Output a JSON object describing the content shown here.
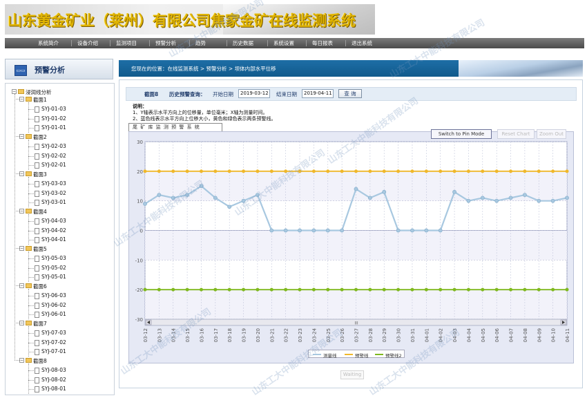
{
  "banner": {
    "title": "山东黄金矿业（莱州）有限公司焦家金矿在线监测系统"
  },
  "menu": [
    {
      "label": "系统简介"
    },
    {
      "label": "设备介绍"
    },
    {
      "label": "监测项目"
    },
    {
      "label": "预警分析"
    },
    {
      "label": "趋势"
    },
    {
      "label": "历史数据"
    },
    {
      "label": "系统设置"
    },
    {
      "label": "每日报表"
    },
    {
      "label": "退出系统"
    }
  ],
  "sidebar": {
    "icon": "chart-icon",
    "title": "预警分析",
    "tree": {
      "root": "浸润线分析",
      "groups": [
        {
          "label": "截面1",
          "items": [
            "SYJ-01-03",
            "SYJ-01-02",
            "SYJ-01-01"
          ]
        },
        {
          "label": "截面2",
          "items": [
            "SYJ-02-03",
            "SYJ-02-02",
            "SYJ-02-01"
          ]
        },
        {
          "label": "截面3",
          "items": [
            "SYJ-03-03",
            "SYJ-03-02",
            "SYJ-03-01"
          ]
        },
        {
          "label": "截面4",
          "items": [
            "SYJ-04-03",
            "SYJ-04-02",
            "SYJ-04-01"
          ]
        },
        {
          "label": "截面5",
          "items": [
            "SYJ-05-03",
            "SYJ-05-02",
            "SYJ-05-01"
          ]
        },
        {
          "label": "截面6",
          "items": [
            "SYJ-06-03",
            "SYJ-06-02",
            "SYJ-06-01"
          ]
        },
        {
          "label": "截面7",
          "items": [
            "SYJ-07-03",
            "SYJ-07-02",
            "SYJ-07-01"
          ]
        },
        {
          "label": "截面8",
          "items": [
            "SYJ-08-03",
            "SYJ-08-02",
            "SYJ-08-01"
          ]
        }
      ]
    }
  },
  "breadcrumb": {
    "text": "您现在的位置：在线监测系统 > 预警分析 > 坝体内部水平位移"
  },
  "query": {
    "section": "截面8",
    "history_label": "历史预警查询：",
    "start_label": "开始日期",
    "start_value": "2019-03-12",
    "end_label": "结束日期",
    "end_value": "2019-04-11",
    "button": "查 询"
  },
  "notes": {
    "heading": "说明：",
    "line1": "1、Y轴表示水平方向上的位移量，单位毫米；X轴为测量时间。",
    "line2": "2、蓝色线表示水平方向上位移大小，黄色和绿色表示两条预警线。"
  },
  "chart_panel": {
    "tab": "尾 矿 库 监 测 预 警 系 统",
    "pin_button": "Switch to Pin Mode",
    "reset_button": "Reset Chart",
    "zoom_button": "Zoom Out",
    "waiting": "Waiting",
    "scroll_grip": "III"
  },
  "watermark": "山东工大中能科技有限公司",
  "colors": {
    "measured": "#a8c8e0",
    "warn1": "#f0b82a",
    "warn2": "#7fb81e"
  },
  "chart_data": {
    "type": "line",
    "x": [
      "03-12",
      "03-13",
      "03-14",
      "03-15",
      "03-16",
      "03-17",
      "03-18",
      "03-19",
      "03-20",
      "03-21",
      "03-22",
      "03-23",
      "03-24",
      "03-25",
      "03-26",
      "03-27",
      "03-28",
      "03-29",
      "03-30",
      "03-31",
      "04-01",
      "04-02",
      "04-03",
      "04-04",
      "04-05",
      "04-06",
      "04-07",
      "04-08",
      "04-09",
      "04-10",
      "04-11"
    ],
    "ylim": [
      -30,
      30
    ],
    "yticks": [
      30,
      20,
      10,
      0,
      -10,
      -20,
      -30
    ],
    "series": [
      {
        "name": "测量线",
        "color": "#a8c8e0",
        "values": [
          9,
          12,
          11,
          12,
          15,
          11,
          8,
          10,
          12,
          0,
          0,
          0,
          0,
          0,
          0,
          14,
          11,
          13,
          0,
          0,
          0,
          0,
          13,
          10,
          11,
          10,
          11,
          12,
          10,
          10,
          11
        ]
      },
      {
        "name": "预警线",
        "color": "#f0b82a",
        "values": [
          20,
          20,
          20,
          20,
          20,
          20,
          20,
          20,
          20,
          20,
          20,
          20,
          20,
          20,
          20,
          20,
          20,
          20,
          20,
          20,
          20,
          20,
          20,
          20,
          20,
          20,
          20,
          20,
          20,
          20,
          20
        ]
      },
      {
        "name": "预警线2",
        "color": "#7fb81e",
        "values": [
          -20,
          -20,
          -20,
          -20,
          -20,
          -20,
          -20,
          -20,
          -20,
          -20,
          -20,
          -20,
          -20,
          -20,
          -20,
          -20,
          -20,
          -20,
          -20,
          -20,
          -20,
          -20,
          -20,
          -20,
          -20,
          -20,
          -20,
          -20,
          -20,
          -20,
          -20
        ]
      }
    ],
    "grid": true,
    "legend": "bottom-center"
  }
}
